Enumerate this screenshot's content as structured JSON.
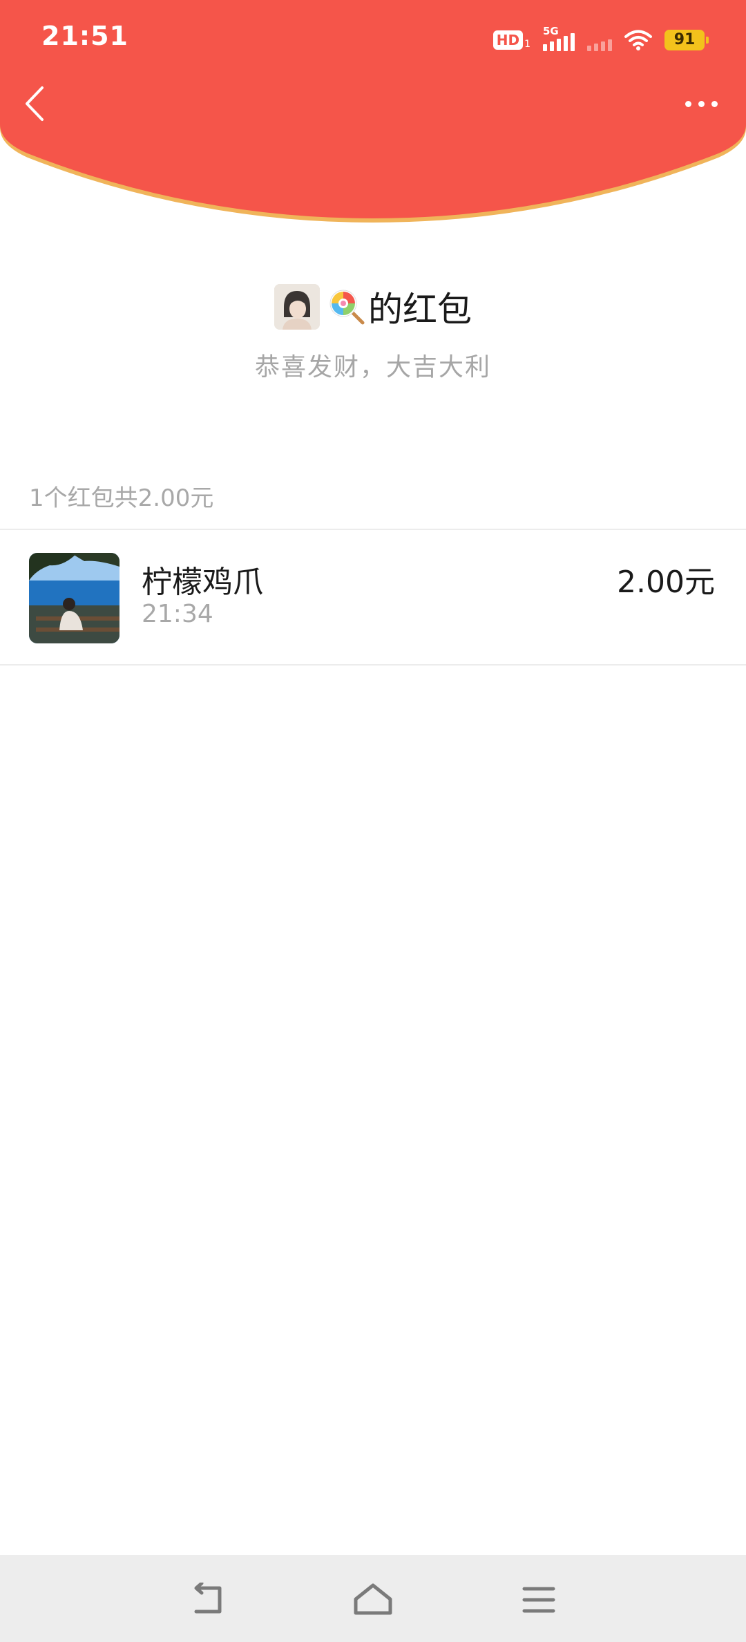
{
  "status_bar": {
    "time": "21:51",
    "hd_label": "HD",
    "hd_sub": "1",
    "network_label": "5G",
    "battery_level": "91"
  },
  "header": {
    "back_icon": "chevron-left-icon",
    "more_icon": "more-dots-icon",
    "colors": {
      "background": "#f5554a",
      "rim": "#f0b45a"
    }
  },
  "sender": {
    "name_suffix": "的红包",
    "emoji": "lollipop-icon",
    "blessing": "恭喜发财，大吉大利"
  },
  "summary": {
    "text": "1个红包共2.00元"
  },
  "records": [
    {
      "name": "柠檬鸡爪",
      "time": "21:34",
      "amount": "2.00元"
    }
  ],
  "navbar": {
    "back_icon": "nav-back-icon",
    "home_icon": "nav-home-icon",
    "menu_icon": "nav-menu-icon"
  }
}
